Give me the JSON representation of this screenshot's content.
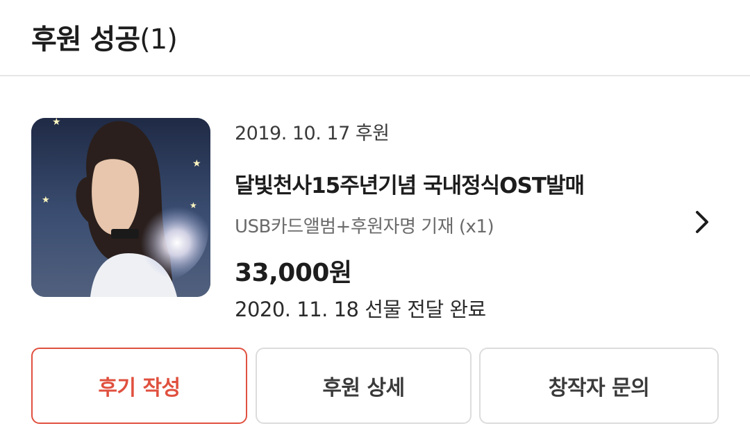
{
  "header": {
    "title": "후원 성공",
    "count": "(1)"
  },
  "pledge": {
    "date": "2019. 10. 17 후원",
    "project_title": "달빛천사15주년기념 국내정식OST발매",
    "reward_option": "USB카드앨범+후원자명 기재 (x1)",
    "amount": "33,000원",
    "delivery_status": "2020. 11. 18 선물 전달 완료"
  },
  "actions": {
    "write_review": "후기 작성",
    "pledge_detail": "후원 상세",
    "contact_creator": "창작자 문의"
  },
  "colors": {
    "accent": "#e0503e",
    "border": "#dcdcdc"
  },
  "icons": {
    "detail_chevron": "chevron-right-icon"
  }
}
